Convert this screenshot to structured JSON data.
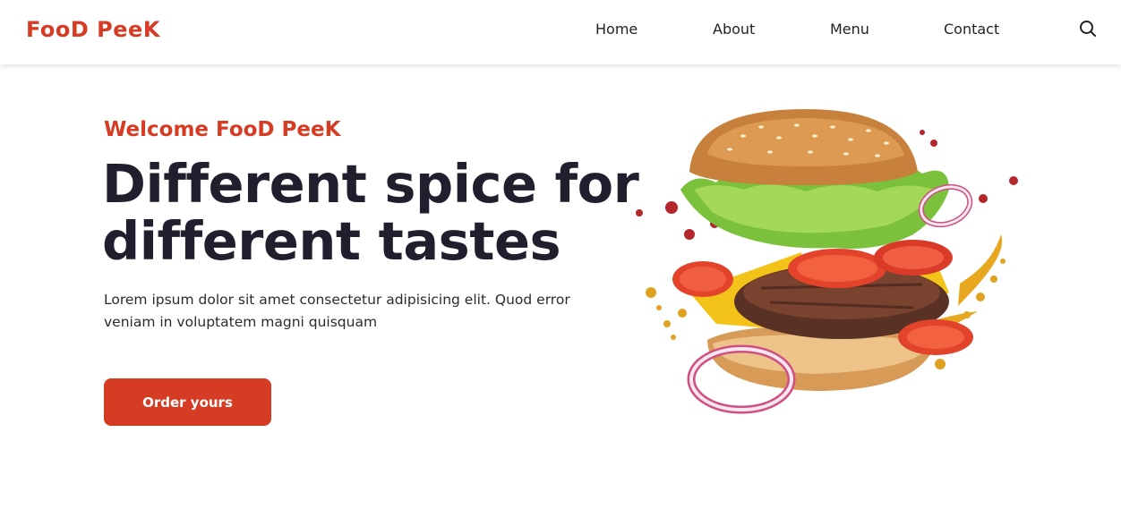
{
  "brand": {
    "logo_part1": "Foo",
    "logo_part2": "D",
    "logo_part3": " Pee",
    "logo_part4": "K"
  },
  "nav": {
    "items": [
      {
        "label": "Home"
      },
      {
        "label": "About"
      },
      {
        "label": "Menu"
      },
      {
        "label": "Contact"
      }
    ],
    "search_icon": "search-icon"
  },
  "hero": {
    "subtitle": "Welcome FooD PeeK",
    "title_line1": "Different spice for",
    "title_line2": "different tastes",
    "description": "Lorem ipsum dolor sit amet consectetur adipisicing elit. Quod error veniam in voluptatem magni quisquam",
    "cta_label": "Order yours",
    "image": "burger-illustration"
  },
  "colors": {
    "accent": "#d63b24",
    "heading": "#1f1f2e",
    "text": "#2b2b2b"
  }
}
